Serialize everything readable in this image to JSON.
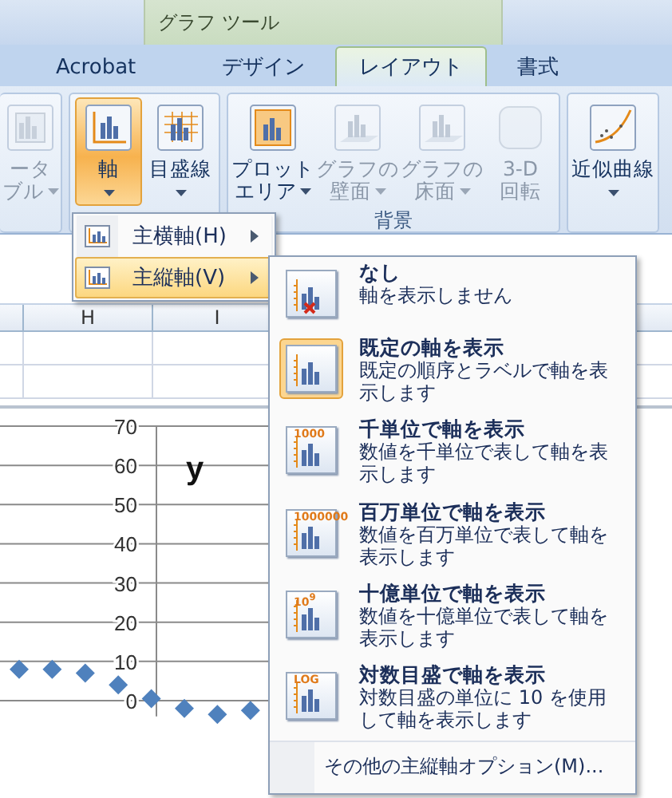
{
  "contextual_tab_group": "グラフ ツール",
  "tabs": [
    {
      "label": "Acrobat",
      "selected": false
    },
    {
      "label": "デザイン",
      "selected": false
    },
    {
      "label": "レイアウト",
      "selected": true
    },
    {
      "label": "書式",
      "selected": false
    }
  ],
  "ribbon_groups": [
    {
      "buttons": [
        {
          "kind": "table",
          "lines": [
            "ータ",
            "ブル"
          ],
          "dropdown": true,
          "pressed": false,
          "disabled": true
        }
      ]
    },
    {
      "buttons": [
        {
          "kind": "axis",
          "lines": [
            "軸"
          ],
          "dropdown": true,
          "pressed": true,
          "disabled": false
        },
        {
          "kind": "gridlines",
          "lines": [
            "目盛線"
          ],
          "dropdown": true,
          "pressed": false,
          "disabled": false
        }
      ]
    },
    {
      "label": "背景",
      "buttons": [
        {
          "kind": "plotarea",
          "lines": [
            "プロット",
            "エリア"
          ],
          "dropdown": true,
          "pressed": false,
          "disabled": false
        },
        {
          "kind": "wall",
          "lines": [
            "グラフの",
            "壁面"
          ],
          "dropdown": true,
          "pressed": false,
          "disabled": true
        },
        {
          "kind": "floor",
          "lines": [
            "グラフの",
            "床面"
          ],
          "dropdown": true,
          "pressed": false,
          "disabled": true
        },
        {
          "kind": "rotation",
          "lines": [
            "3-D",
            "回転"
          ],
          "dropdown": false,
          "pressed": false,
          "disabled": true
        }
      ]
    },
    {
      "buttons": [
        {
          "kind": "trendline",
          "lines": [
            "近似曲線"
          ],
          "dropdown": true,
          "pressed": false,
          "disabled": false
        }
      ]
    }
  ],
  "sheet": {
    "columns": [
      "H",
      "I"
    ]
  },
  "chart": {
    "chart_data": {
      "type": "scatter",
      "title": "y",
      "grid": true,
      "ylim": [
        -4,
        70
      ],
      "yticks": [
        0,
        10,
        20,
        30,
        40,
        50,
        60,
        70
      ],
      "series": [
        {
          "color": "#4f81bd",
          "values": [
            8,
            8,
            7,
            4,
            0.5,
            -2,
            -3.5,
            -2.5
          ]
        }
      ]
    }
  },
  "axis_menu": {
    "items": [
      {
        "label": "主横軸(H)",
        "selected": false
      },
      {
        "label": "主縦軸(V)",
        "selected": true
      }
    ]
  },
  "vertical_axis_menu": {
    "items": [
      {
        "kind": "none",
        "title": "なし",
        "description": "軸を表示しません",
        "selected": false
      },
      {
        "kind": "default",
        "title": "既定の軸を表示",
        "description": "既定の順序とラベルで軸を表示します",
        "selected": true
      },
      {
        "kind": "unit",
        "icon_label": "1000",
        "title": "千単位で軸を表示",
        "description": "数値を千単位で表して軸を表示します",
        "selected": false
      },
      {
        "kind": "unit",
        "icon_label": "1000000",
        "title": "百万単位で軸を表示",
        "description": "数値を百万単位で表して軸を表示します",
        "selected": false
      },
      {
        "kind": "unit",
        "icon_label": "10$^{9}$",
        "title": "十億単位で軸を表示",
        "description": "数値を十億単位で表して軸を表示します",
        "selected": false
      },
      {
        "kind": "unit",
        "icon_label": "LOG",
        "title": "対数目盛で軸を表示",
        "description": "対数目盛の単位に 10 を使用して軸を表示します",
        "selected": false
      }
    ],
    "more_options": "その他の主縦軸オプション(M)..."
  }
}
